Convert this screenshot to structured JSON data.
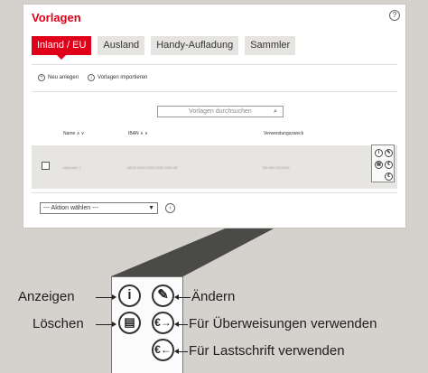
{
  "panel": {
    "title": "Vorlagen",
    "help_glyph": "?"
  },
  "tabs": [
    {
      "label": "Inland / EU",
      "active": true
    },
    {
      "label": "Ausland",
      "active": false
    },
    {
      "label": "Handy-Aufladung",
      "active": false
    },
    {
      "label": "Sammler",
      "active": false
    }
  ],
  "top_actions": {
    "new_label": "Neu anlegen",
    "import_label": "Vorlagen importieren"
  },
  "search": {
    "placeholder": "Vorlagen durchsuchen"
  },
  "table": {
    "columns": [
      "Name ∧ ∨",
      "IBAN ∧ ∨",
      "Verwendungszweck"
    ],
    "row": {
      "name": "Haendler 1",
      "iban": "DE00 0000 0000 0000 0000 00",
      "purpose": "RE-NR 2412403"
    }
  },
  "bulk": {
    "select_value": "--- Aktion wählen ---"
  },
  "legend": {
    "show": "Anzeigen",
    "edit": "Ändern",
    "delete": "Löschen",
    "transfer": "Für Überweisungen verwenden",
    "debit": "Für Lastschrift verwenden"
  },
  "icons": {
    "info": "info-icon",
    "edit": "pencil-icon",
    "delete": "trash-icon",
    "transfer": "euro-arrow-right-icon",
    "debit": "euro-arrow-left-icon"
  },
  "colors": {
    "accent": "#e0001a",
    "background": "#d5d2cd",
    "row": "#e7e5e2"
  }
}
